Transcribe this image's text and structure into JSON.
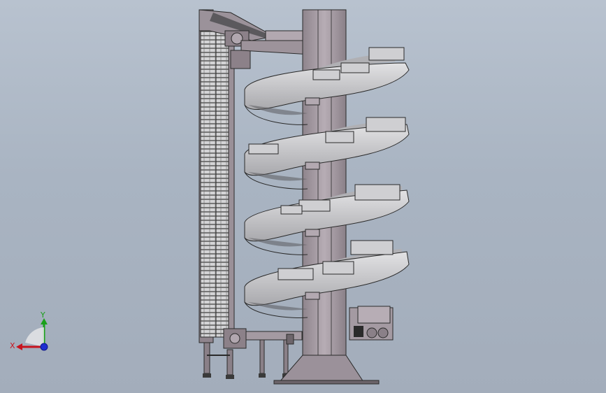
{
  "viewport": {
    "background": "#a9b4c2"
  },
  "model": {
    "name": "spiral-conveyor",
    "frame_color": "#8a7f86",
    "belt_color": "#c9c9cc",
    "column_color": "#a49aa2",
    "edge_color": "#2a2a2a"
  },
  "triad": {
    "x_label": "X",
    "y_label": "Y",
    "x_color": "#c8141e",
    "y_color": "#1aa01a",
    "z_color": "#1e2fd0"
  }
}
